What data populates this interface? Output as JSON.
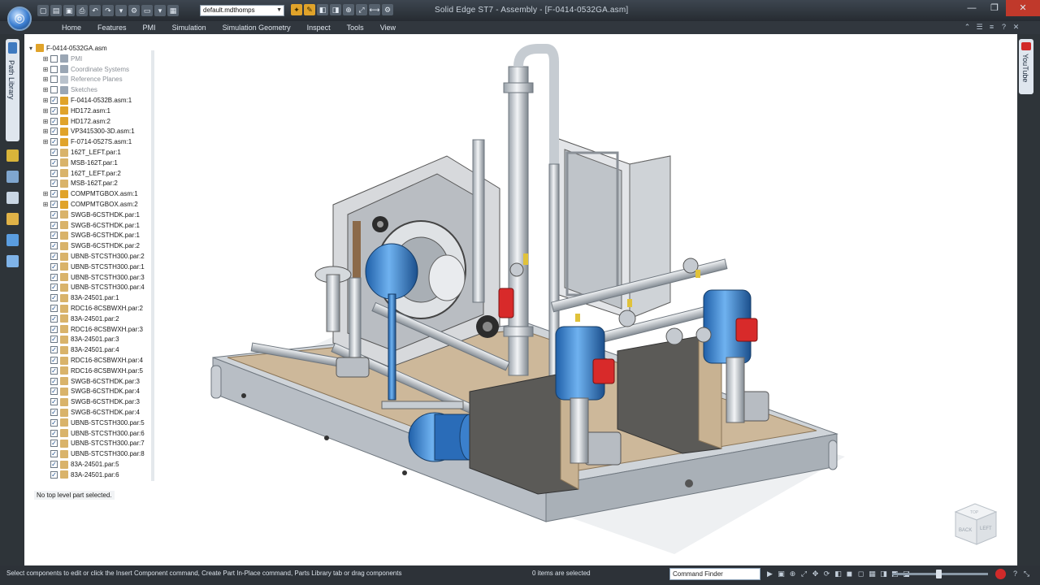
{
  "window": {
    "title": "Solid Edge ST7 - Assembly - [F-0414-0532GA.asm]",
    "config": "default.mdthomps"
  },
  "tabs": [
    "Home",
    "Features",
    "PMI",
    "Simulation",
    "Simulation Geometry",
    "Inspect",
    "Tools",
    "View"
  ],
  "side_tabs": {
    "left": "Path Library",
    "right": "YouTube"
  },
  "tree": {
    "root": "F-0414-0532GA.asm",
    "nodes": [
      {
        "label": "PMI",
        "dim": true,
        "checked": false,
        "expander": true,
        "icon": "#9aa6b4"
      },
      {
        "label": "Coordinate Systems",
        "dim": true,
        "checked": false,
        "expander": true,
        "icon": "#9aa6b4"
      },
      {
        "label": "Reference Planes",
        "dim": true,
        "checked": false,
        "expander": true,
        "icon": "#b9c2cc"
      },
      {
        "label": "Sketches",
        "dim": true,
        "checked": false,
        "expander": true,
        "icon": "#9aa6b4"
      },
      {
        "label": "F-0414-0532B.asm:1",
        "dim": false,
        "checked": true,
        "expander": true,
        "icon": "#e0a32a"
      },
      {
        "label": "HD172.asm:1",
        "dim": false,
        "checked": true,
        "expander": true,
        "icon": "#e0a32a"
      },
      {
        "label": "HD172.asm:2",
        "dim": false,
        "checked": true,
        "expander": true,
        "icon": "#e0a32a"
      },
      {
        "label": "VP3415300-3D.asm:1",
        "dim": false,
        "checked": true,
        "expander": true,
        "icon": "#e0a32a"
      },
      {
        "label": "F-0714-0527S.asm:1",
        "dim": false,
        "checked": true,
        "expander": true,
        "icon": "#e0a32a"
      },
      {
        "label": "162T_LEFT.par:1",
        "dim": false,
        "checked": true,
        "expander": false,
        "icon": "#d9b36a"
      },
      {
        "label": "MSB-162T.par:1",
        "dim": false,
        "checked": true,
        "expander": false,
        "icon": "#d9b36a"
      },
      {
        "label": "162T_LEFT.par:2",
        "dim": false,
        "checked": true,
        "expander": false,
        "icon": "#d9b36a"
      },
      {
        "label": "MSB-162T.par:2",
        "dim": false,
        "checked": true,
        "expander": false,
        "icon": "#d9b36a"
      },
      {
        "label": "COMPMTGBOX.asm:1",
        "dim": false,
        "checked": true,
        "expander": true,
        "icon": "#e0a32a"
      },
      {
        "label": "COMPMTGBOX.asm:2",
        "dim": false,
        "checked": true,
        "expander": true,
        "icon": "#e0a32a"
      },
      {
        "label": "SWGB-6CSTHDK.par:1",
        "dim": false,
        "checked": true,
        "expander": false,
        "icon": "#d9b36a"
      },
      {
        "label": "SWGB-6CSTHDK.par:1",
        "dim": false,
        "checked": true,
        "expander": false,
        "icon": "#d9b36a"
      },
      {
        "label": "SWGB-6CSTHDK.par:1",
        "dim": false,
        "checked": true,
        "expander": false,
        "icon": "#d9b36a"
      },
      {
        "label": "SWGB-6CSTHDK.par:2",
        "dim": false,
        "checked": true,
        "expander": false,
        "icon": "#d9b36a"
      },
      {
        "label": "UBNB-STCSTH300.par:2",
        "dim": false,
        "checked": true,
        "expander": false,
        "icon": "#d9b36a"
      },
      {
        "label": "UBNB-STCSTH300.par:1",
        "dim": false,
        "checked": true,
        "expander": false,
        "icon": "#d9b36a"
      },
      {
        "label": "UBNB-STCSTH300.par:3",
        "dim": false,
        "checked": true,
        "expander": false,
        "icon": "#d9b36a"
      },
      {
        "label": "UBNB-STCSTH300.par:4",
        "dim": false,
        "checked": true,
        "expander": false,
        "icon": "#d9b36a"
      },
      {
        "label": "83A-24501.par:1",
        "dim": false,
        "checked": true,
        "expander": false,
        "icon": "#d9b36a"
      },
      {
        "label": "RDC16-8CSBWXH.par:2",
        "dim": false,
        "checked": true,
        "expander": false,
        "icon": "#d9b36a"
      },
      {
        "label": "83A-24501.par:2",
        "dim": false,
        "checked": true,
        "expander": false,
        "icon": "#d9b36a"
      },
      {
        "label": "RDC16-8CSBWXH.par:3",
        "dim": false,
        "checked": true,
        "expander": false,
        "icon": "#d9b36a"
      },
      {
        "label": "83A-24501.par:3",
        "dim": false,
        "checked": true,
        "expander": false,
        "icon": "#d9b36a"
      },
      {
        "label": "83A-24501.par:4",
        "dim": false,
        "checked": true,
        "expander": false,
        "icon": "#d9b36a"
      },
      {
        "label": "RDC16-8CSBWXH.par:4",
        "dim": false,
        "checked": true,
        "expander": false,
        "icon": "#d9b36a"
      },
      {
        "label": "RDC16-8CSBWXH.par:5",
        "dim": false,
        "checked": true,
        "expander": false,
        "icon": "#d9b36a"
      },
      {
        "label": "SWGB-6CSTHDK.par:3",
        "dim": false,
        "checked": true,
        "expander": false,
        "icon": "#d9b36a"
      },
      {
        "label": "SWGB-6CSTHDK.par:4",
        "dim": false,
        "checked": true,
        "expander": false,
        "icon": "#d9b36a"
      },
      {
        "label": "SWGB-6CSTHDK.par:3",
        "dim": false,
        "checked": true,
        "expander": false,
        "icon": "#d9b36a"
      },
      {
        "label": "SWGB-6CSTHDK.par:4",
        "dim": false,
        "checked": true,
        "expander": false,
        "icon": "#d9b36a"
      },
      {
        "label": "UBNB-STCSTH300.par:5",
        "dim": false,
        "checked": true,
        "expander": false,
        "icon": "#d9b36a"
      },
      {
        "label": "UBNB-STCSTH300.par:6",
        "dim": false,
        "checked": true,
        "expander": false,
        "icon": "#d9b36a"
      },
      {
        "label": "UBNB-STCSTH300.par:7",
        "dim": false,
        "checked": true,
        "expander": false,
        "icon": "#d9b36a"
      },
      {
        "label": "UBNB-STCSTH300.par:8",
        "dim": false,
        "checked": true,
        "expander": false,
        "icon": "#d9b36a"
      },
      {
        "label": "83A-24501.par:5",
        "dim": false,
        "checked": true,
        "expander": false,
        "icon": "#d9b36a"
      },
      {
        "label": "83A-24501.par:6",
        "dim": false,
        "checked": true,
        "expander": false,
        "icon": "#d9b36a"
      }
    ],
    "selection_status": "No top level part selected."
  },
  "status": {
    "prompt": "Select components to edit or click the Insert Component command, Create Part In-Place command, Parts Library tab or drag components",
    "items_selected": "0 items are selected",
    "command_finder": "Command Finder"
  },
  "viewcube": {
    "front": "BACK",
    "side": "LEFT",
    "top": "TOP"
  },
  "colors": {
    "accent": "#e0a32a",
    "blue_equipment": "#2f77c9",
    "red_fitting": "#d82a2a",
    "deck": "#cdb89a",
    "frame": "#c9ced4"
  }
}
